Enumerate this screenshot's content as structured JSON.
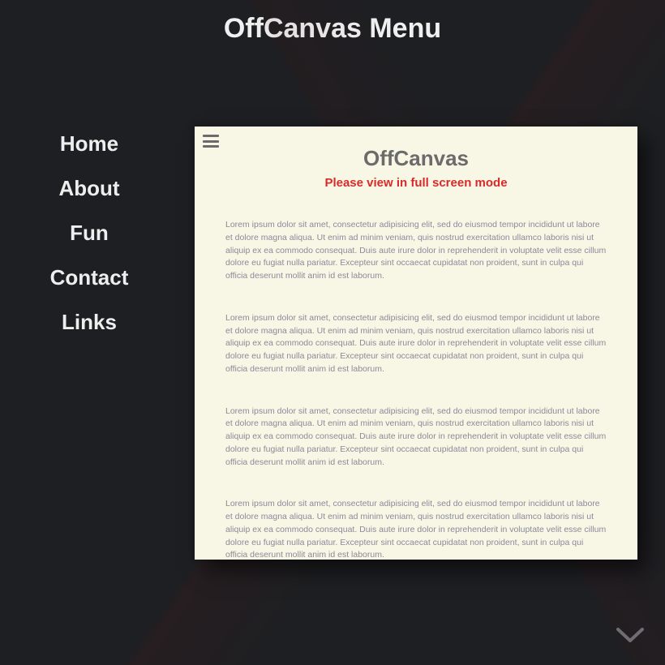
{
  "page_title": "OffCanvas Menu",
  "nav": {
    "items": [
      {
        "label": "Home"
      },
      {
        "label": "About"
      },
      {
        "label": "Fun"
      },
      {
        "label": "Contact"
      },
      {
        "label": "Links"
      }
    ]
  },
  "card": {
    "title": "OffCanvas",
    "subtitle": "Please view in full screen mode",
    "paragraphs": [
      "Lorem ipsum dolor sit amet, consectetur adipisicing elit, sed do eiusmod tempor incididunt ut labore et dolore magna aliqua. Ut enim ad minim veniam, quis nostrud exercitation ullamco laboris nisi ut aliquip ex ea commodo consequat. Duis aute irure dolor in reprehenderit in voluptate velit esse cillum dolore eu fugiat nulla pariatur. Excepteur sint occaecat cupidatat non proident, sunt in culpa qui officia deserunt mollit anim id est laborum.",
      "Lorem ipsum dolor sit amet, consectetur adipisicing elit, sed do eiusmod tempor incididunt ut labore et dolore magna aliqua. Ut enim ad minim veniam, quis nostrud exercitation ullamco laboris nisi ut aliquip ex ea commodo consequat. Duis aute irure dolor in reprehenderit in voluptate velit esse cillum dolore eu fugiat nulla pariatur. Excepteur sint occaecat cupidatat non proident, sunt in culpa qui officia deserunt mollit anim id est laborum.",
      "Lorem ipsum dolor sit amet, consectetur adipisicing elit, sed do eiusmod tempor incididunt ut labore et dolore magna aliqua. Ut enim ad minim veniam, quis nostrud exercitation ullamco laboris nisi ut aliquip ex ea commodo consequat. Duis aute irure dolor in reprehenderit in voluptate velit esse cillum dolore eu fugiat nulla pariatur. Excepteur sint occaecat cupidatat non proident, sunt in culpa qui officia deserunt mollit anim id est laborum.",
      "Lorem ipsum dolor sit amet, consectetur adipisicing elit, sed do eiusmod tempor incididunt ut labore et dolore magna aliqua. Ut enim ad minim veniam, quis nostrud exercitation ullamco laboris nisi ut aliquip ex ea commodo consequat. Duis aute irure dolor in reprehenderit in voluptate velit esse cillum dolore eu fugiat nulla pariatur. Excepteur sint occaecat cupidatat non proident, sunt in culpa qui officia deserunt mollit anim id est laborum."
    ]
  },
  "colors": {
    "bg": "#1e1f22",
    "card_bg": "#f8f6e4",
    "accent_red": "#d92a2a",
    "text_muted": "#6b6b6b",
    "body_text": "#8b8a9a"
  }
}
